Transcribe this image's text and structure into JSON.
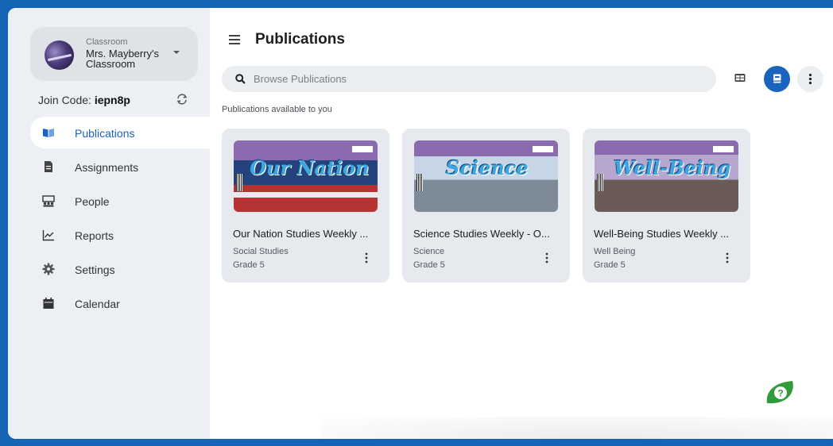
{
  "sidebar": {
    "classroom_label": "Classroom",
    "classroom_name": "Mrs. Mayberry's Classroom",
    "join_label": "Join Code: ",
    "join_code": "iepn8p",
    "items": [
      {
        "label": "Publications",
        "icon": "book-icon",
        "active": true
      },
      {
        "label": "Assignments",
        "icon": "document-icon",
        "active": false
      },
      {
        "label": "People",
        "icon": "people-icon",
        "active": false
      },
      {
        "label": "Reports",
        "icon": "chart-icon",
        "active": false
      },
      {
        "label": "Settings",
        "icon": "gear-icon",
        "active": false
      },
      {
        "label": "Calendar",
        "icon": "calendar-icon",
        "active": false
      }
    ]
  },
  "header": {
    "title": "Publications"
  },
  "search": {
    "placeholder": "Browse Publications"
  },
  "main": {
    "subheading": "Publications available to you",
    "cards": [
      {
        "title": "Our Nation Studies Weekly ...",
        "subject": "Social Studies",
        "grade": "Grade 5",
        "cover_text": "Our Nation",
        "cover_color": "#b8c6dc"
      },
      {
        "title": "Science Studies Weekly - O...",
        "subject": "Science",
        "grade": "Grade 5",
        "cover_text": "Science",
        "cover_color": "#9fb3c6"
      },
      {
        "title": "Well-Being Studies Weekly ...",
        "subject": "Well Being",
        "grade": "Grade 5",
        "cover_text": "Well-Being",
        "cover_color": "#c4b7d4"
      }
    ]
  },
  "colors": {
    "accent": "#1a64c0",
    "frame": "#1565b4",
    "help": "#2f9b3b"
  }
}
